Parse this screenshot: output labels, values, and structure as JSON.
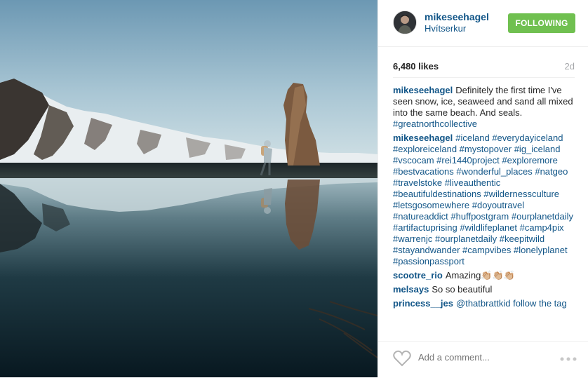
{
  "post": {
    "username": "mikeseehagel",
    "location": "Hvítserkur",
    "follow_label": "FOLLOWING",
    "likes": "6,480 likes",
    "ago": "2d",
    "caption": "Definitely the first time I've seen snow, ice, seaweed and sand all mixed into the same beach. And seals.",
    "caption_tag": "#greatnorthcollective",
    "tags": "#iceland #everydayiceland #exploreiceland #mystopover #ig_iceland #vscocam #rei1440project #exploremore #bestvacations #wonderful_places #natgeo #travelstoke #liveauthentic #beautifuldestinations #wildernessculture #letsgosomewhere #doyoutravel #natureaddict #huffpostgram #ourplanetdaily #artifactuprising #wildlifeplanet #camp4pix #warrenjc #ourplanetdaily #keepitwild #stayandwander #campvibes #lonelyplanet #passionpassport"
  },
  "comments": [
    {
      "user": "scootre_rio",
      "text": "Amazing👏🏼👏🏼👏🏼"
    },
    {
      "user": "melsays",
      "text": "So so beautiful"
    },
    {
      "user": "princess__jes",
      "text": "@thatbrattkid follow the tag"
    }
  ],
  "footer": {
    "placeholder": "Add a comment..."
  },
  "icons": {
    "heart": "heart-icon",
    "more": "more-options-icon"
  },
  "colors": {
    "link": "#125688",
    "follow_bg": "#70c050",
    "muted": "#a5a7aa"
  }
}
